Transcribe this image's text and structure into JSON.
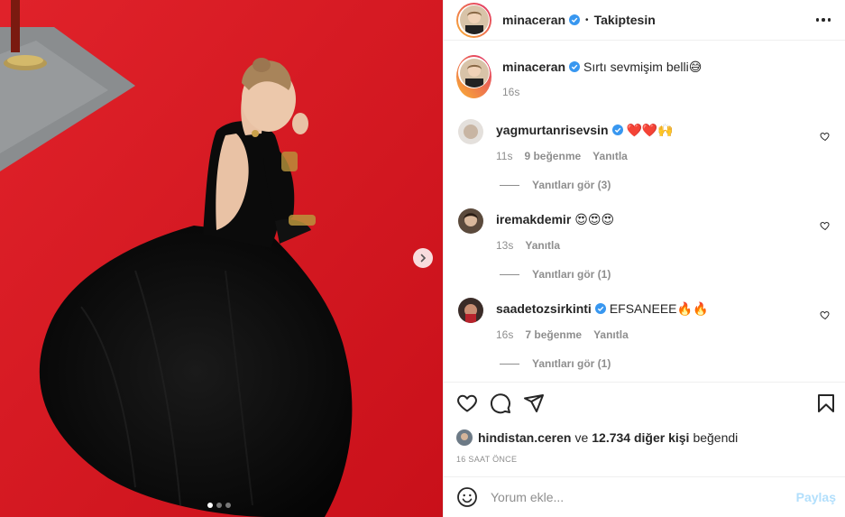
{
  "post": {
    "author": "minaceran",
    "follow_label": "Takiptesin",
    "separator": "•",
    "caption": "Sırtı sevmişim belli😅",
    "caption_time": "16s"
  },
  "comments": [
    {
      "user": "yagmurtanrisevsin",
      "verified": true,
      "text": "❤️❤️🙌",
      "time": "11s",
      "likes": "9 beğenme",
      "reply": "Yanıtla",
      "view_replies": "Yanıtları gör (3)"
    },
    {
      "user": "iremakdemir",
      "verified": false,
      "text": "😍😍😍",
      "time": "13s",
      "likes": "",
      "reply": "Yanıtla",
      "view_replies": "Yanıtları gör (1)"
    },
    {
      "user": "saadetozsirkinti",
      "verified": true,
      "text": "EFSANEEE🔥🔥",
      "time": "16s",
      "likes": "7 beğenme",
      "reply": "Yanıtla",
      "view_replies": "Yanıtları gör (1)"
    }
  ],
  "likes": {
    "user": "hindistan.ceren",
    "conj": "ve",
    "others": "12.734 diğer kişi",
    "suffix": "beğendi"
  },
  "timestamp": "16 SAAT ÖNCE",
  "comment_box": {
    "placeholder": "Yorum ekle...",
    "post_label": "Paylaş"
  },
  "carousel": {
    "total": 3,
    "active": 1
  },
  "colors": {
    "carpet": "#d9161f",
    "verified": "#3897f0",
    "post_disabled": "#b2dffc"
  }
}
